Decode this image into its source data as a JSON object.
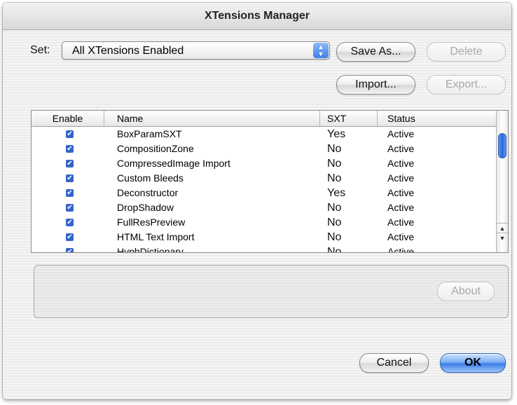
{
  "window": {
    "title": "XTensions Manager"
  },
  "set": {
    "label": "Set:",
    "value": "All XTensions Enabled"
  },
  "buttons": {
    "save_as": "Save As...",
    "delete": "Delete",
    "import": "Import...",
    "export": "Export...",
    "about": "About",
    "cancel": "Cancel",
    "ok": "OK"
  },
  "table": {
    "columns": [
      "Enable",
      "Name",
      "SXT",
      "Status"
    ],
    "rows": [
      {
        "name": "BoxParamSXT",
        "sxt": "Yes",
        "status": "Active"
      },
      {
        "name": "CompositionZone",
        "sxt": "No",
        "status": "Active"
      },
      {
        "name": "CompressedImage Import",
        "sxt": "No",
        "status": "Active"
      },
      {
        "name": "Custom Bleeds",
        "sxt": "No",
        "status": "Active"
      },
      {
        "name": "Deconstructor",
        "sxt": "Yes",
        "status": "Active"
      },
      {
        "name": "DropShadow",
        "sxt": "No",
        "status": "Active"
      },
      {
        "name": "FullResPreview",
        "sxt": "No",
        "status": "Active"
      },
      {
        "name": "HTML Text Import",
        "sxt": "No",
        "status": "Active"
      },
      {
        "name": "HyphDictionary",
        "sxt": "No",
        "status": "Active"
      }
    ],
    "checkmark": "✔"
  },
  "icons": {
    "checkbox": "checkbox-checked-icon",
    "scroll_up": "▲",
    "scroll_down": "▼",
    "popup_arrows": "▲▼"
  },
  "colors": {
    "accent": "#3b7ee6",
    "window_bg": "#ececec"
  }
}
